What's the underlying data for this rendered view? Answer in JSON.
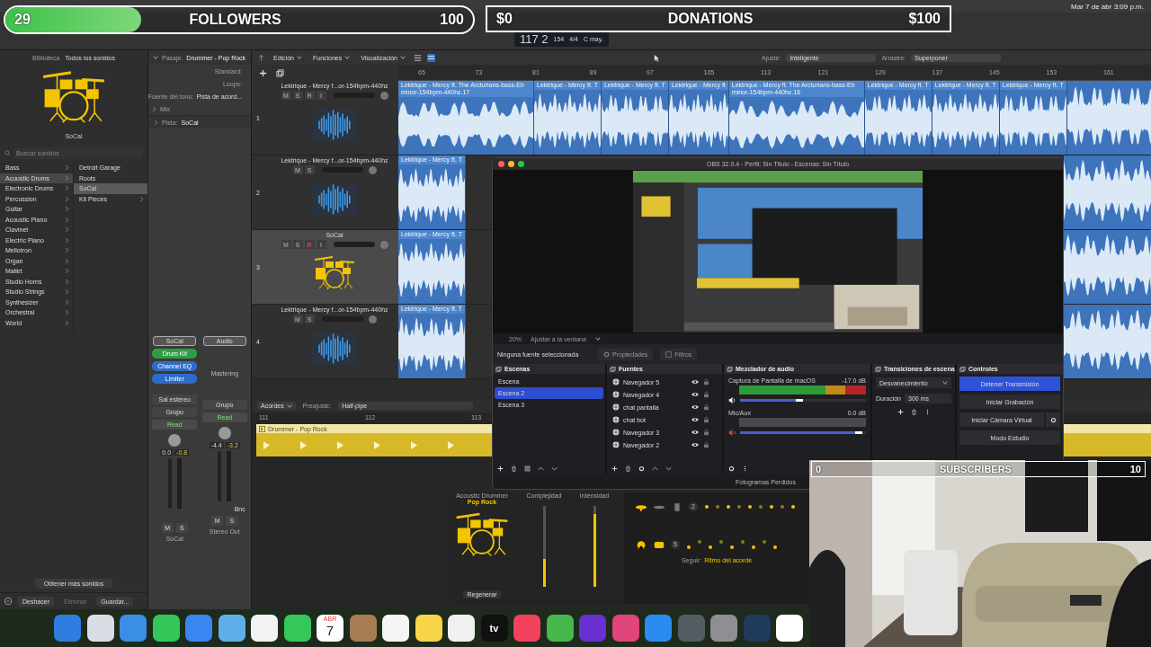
{
  "overlay": {
    "followers": {
      "count": "29",
      "label": "FOLLOWERS",
      "goal": "100",
      "level": 0.29
    },
    "donations": {
      "count": "$0",
      "label": "DONATIONS",
      "goal": "$100",
      "level": 0
    },
    "subscribers": {
      "count": "0",
      "label": "SUBSCRIBERS",
      "goal": "10",
      "level": 0
    }
  },
  "menu_bar": {
    "clock": "Mar 7 de abr  3:09 p.m."
  },
  "control_bar": {
    "position": "117 2",
    "tempo": "154",
    "signature": "4/4",
    "key": "C may."
  },
  "library": {
    "header": "Biblioteca",
    "scope": "Todos los sonidos",
    "selected_sound": "SoCal",
    "search": {
      "placeholder": "Buscar sonidos"
    },
    "categories": [
      {
        "label": "Bass",
        "selected": false
      },
      {
        "label": "Acoustic Drums",
        "selected": true
      },
      {
        "label": "Electronic Drums",
        "selected": false
      },
      {
        "label": "Percussion",
        "selected": false
      },
      {
        "label": "Guitar",
        "selected": false
      },
      {
        "label": "Acoustic Piano",
        "selected": false
      },
      {
        "label": "Clavinet",
        "selected": false
      },
      {
        "label": "Electric Piano",
        "selected": false
      },
      {
        "label": "Mellotron",
        "selected": false
      },
      {
        "label": "Organ",
        "selected": false
      },
      {
        "label": "Mallet",
        "selected": false
      },
      {
        "label": "Studio Horns",
        "selected": false
      },
      {
        "label": "Studio Strings",
        "selected": false
      },
      {
        "label": "Synthesizer",
        "selected": false
      },
      {
        "label": "Orchestral",
        "selected": false
      },
      {
        "label": "World",
        "selected": false
      }
    ],
    "subcategories": [
      {
        "label": "Detroit Garage",
        "selected": false,
        "expandable": false
      },
      {
        "label": "Roots",
        "selected": false,
        "expandable": false
      },
      {
        "label": "SoCal",
        "selected": true,
        "expandable": false
      },
      {
        "label": "Kit Pieces",
        "selected": false,
        "expandable": true
      }
    ],
    "get_more": "Obtener más sonidos",
    "footer_buttons": [
      {
        "label": "Deshacer",
        "disabled": false
      },
      {
        "label": "Eliminar",
        "disabled": true
      },
      {
        "label": "Guardar...",
        "disabled": false
      }
    ]
  },
  "inspector": {
    "region_label": "Pasaje:",
    "region": "Drummer - Pop Rock",
    "settings": [
      {
        "label": "Standard:"
      },
      {
        "label": "Loops:"
      },
      {
        "label": "Fuente del tono:",
        "value": "Pista de acord..."
      }
    ],
    "mix": "Mix",
    "track_label": "Pista:",
    "track": "SoCal",
    "strips": [
      {
        "setting": "SoCal",
        "plugins": [
          {
            "label": "Drum Kit",
            "color": "#2e9e46"
          },
          {
            "label": "Channel EQ",
            "color": "#2f6cc8"
          },
          {
            "label": "Limiter",
            "color": "#2f6cc8"
          }
        ],
        "output": "Sal estéreo",
        "group": "Grupo",
        "automation": "Read",
        "pan": "0.0",
        "peak": "-0.8",
        "buttons": [
          "M",
          "S"
        ],
        "name": "SoCal"
      },
      {
        "setting": "Audio",
        "extra": "Mastering",
        "group": "Grupo",
        "automation": "Read",
        "pan": "-4.4",
        "peak": "-3.2",
        "bounce": "Bnc",
        "buttons": [
          "M",
          "S"
        ],
        "name": "Stereo Out"
      }
    ]
  },
  "tracks": {
    "menus": [
      "Edición",
      "Funciones",
      "Visualización"
    ],
    "snap_label": "Ajuste:",
    "snap": "Inteligente",
    "drag_label": "Arrastre:",
    "drag": "Superponer",
    "ruler": [
      "65",
      "73",
      "81",
      "89",
      "97",
      "105",
      "113",
      "121",
      "129",
      "137",
      "145",
      "153",
      "161"
    ],
    "list": [
      {
        "number": "1",
        "name": "Lektrique - Mercy f...or-154bpm-440hz",
        "kind": "audio",
        "selected": false,
        "buttons": [
          "M",
          "S",
          "R",
          "I"
        ],
        "record_armed": false,
        "regions": [
          "Lektrique - Mercy ft. The Arcturians-bass-Eb minor-154bpm-440hz.17",
          "Lektrique - Mercy ft. T",
          "Lektrique - Mercy ft. T",
          "Lektrique - Mercy ft",
          "Lektrique - Mercy ft. The Arcturians-bass-Eb minor-154bpm-440hz.16",
          "Lektrique - Mercy ft. T",
          "Lektrique - Mercy ft. T",
          "Lektrique - Mercy ft. T"
        ]
      },
      {
        "number": "2",
        "name": "Lektrique - Mercy f...or-154bpm-440hz",
        "kind": "audio",
        "selected": false,
        "buttons": [
          "M",
          "S"
        ],
        "regions": [
          "Lektrique - Mercy ft. T"
        ]
      },
      {
        "number": "3",
        "name": "SoCal",
        "kind": "drummer",
        "selected": true,
        "buttons": [
          "M",
          "S",
          "R",
          "I"
        ],
        "record_armed": true,
        "regions": [
          "Lektrique - Mercy ft. T"
        ]
      },
      {
        "number": "4",
        "name": "Lektrique - Mercy f...or-154bpm-440hz",
        "kind": "audio",
        "selected": false,
        "buttons": [
          "M",
          "S"
        ],
        "regions": [
          "Lektrique - Mercy ft. T"
        ]
      }
    ]
  },
  "editor": {
    "chord_menu": "Acordes",
    "preset_label": "Preajuste:",
    "preset": "Half-pipe",
    "ruler": [
      "111",
      "112",
      "113"
    ],
    "region": "Drummer - Pop Rock"
  },
  "drummer": {
    "style": "Acoustic Drummer",
    "preset": "Pop Rock",
    "sliders": [
      {
        "label": "Complejidad",
        "level": 0.35
      },
      {
        "label": "Intensidad",
        "level": 0.9
      }
    ],
    "regenerate": "Regenerar",
    "pattern_counts": [
      "2",
      "5"
    ],
    "follow_label": "Seguir:",
    "follow": "Ritmo del acorde"
  },
  "obs": {
    "title": "OBS 32.0.4 - Perfil: Sin Título - Escenas: Sin Título",
    "zoom": "20%",
    "fit": "Ajustar a la ventana",
    "no_source": "Ninguna fuente seleccionada",
    "tool_buttons": [
      "Propiedades",
      "Filtros"
    ],
    "scenes": {
      "title": "Escenas",
      "items": [
        {
          "label": "Escena",
          "selected": false
        },
        {
          "label": "Escena 2",
          "selected": true
        },
        {
          "label": "Escena 3",
          "selected": false
        }
      ]
    },
    "sources": {
      "title": "Fuentes",
      "items": [
        {
          "label": "Navegador 5",
          "visible": true,
          "locked": false
        },
        {
          "label": "Navegador 4",
          "visible": true,
          "locked": false
        },
        {
          "label": "chat pantalla",
          "visible": true,
          "locked": false
        },
        {
          "label": "chat bot",
          "visible": true,
          "locked": false
        },
        {
          "label": "Navegador 3",
          "visible": true,
          "locked": false
        },
        {
          "label": "Navegador 2",
          "visible": true,
          "locked": false
        }
      ]
    },
    "mixer": {
      "title": "Mezclador de audio",
      "channels": [
        {
          "name": "Captura de Pantalla de macOS",
          "reading": "-17.0 dB",
          "signal": true,
          "muted": false,
          "level": 0.5
        },
        {
          "name": "Mic/Aux",
          "reading": "0.0 dB",
          "signal": false,
          "muted": true,
          "level": 0.97
        }
      ]
    },
    "transitions": {
      "title": "Transiciones de escena",
      "type": "Desvanecimiento",
      "duration_label": "Duración",
      "duration": "300 ms"
    },
    "controls": {
      "title": "Controles",
      "buttons": [
        {
          "label": "Detener Transmisión",
          "active": true,
          "settings": false
        },
        {
          "label": "Iniciar Grabación",
          "active": false,
          "settings": false
        },
        {
          "label": "Iniciar Cámara Virtual",
          "active": false,
          "settings": true
        },
        {
          "label": "Modo Estudio",
          "active": false,
          "settings": false
        }
      ]
    },
    "status": "Fotogramas Perdidos"
  },
  "dock": [
    {
      "kind": "app",
      "color": "#2f7de1"
    },
    {
      "kind": "app",
      "color": "#d9dde6"
    },
    {
      "kind": "app",
      "color": "#3a8ee6"
    },
    {
      "kind": "app",
      "color": "#33c759"
    },
    {
      "kind": "app",
      "color": "#3a86f0"
    },
    {
      "kind": "app",
      "color": "#5fb0e8"
    },
    {
      "kind": "app",
      "color": "#f2f2f2"
    },
    {
      "kind": "app",
      "color": "#34c759"
    },
    {
      "kind": "calendar",
      "month": "ABR",
      "day": "7"
    },
    {
      "kind": "app",
      "color": "#a67c52"
    },
    {
      "kind": "app",
      "color": "#f5f5f5"
    },
    {
      "kind": "app",
      "color": "#f7d44a"
    },
    {
      "kind": "app",
      "color": "#f0f0f0"
    },
    {
      "kind": "tv",
      "label": "tv"
    },
    {
      "kind": "app",
      "color": "#f2425c"
    },
    {
      "kind": "app",
      "color": "#46b74a"
    },
    {
      "kind": "app",
      "color": "#6a2fd0"
    },
    {
      "kind": "app",
      "color": "#e0457b"
    },
    {
      "kind": "app",
      "color": "#2a8cf0"
    },
    {
      "kind": "app",
      "color": "#555b63"
    },
    {
      "kind": "app",
      "color": "#8e8e93"
    },
    {
      "kind": "app",
      "color": "#1f3b5c"
    },
    {
      "kind": "app",
      "color": "#ffffff"
    }
  ]
}
